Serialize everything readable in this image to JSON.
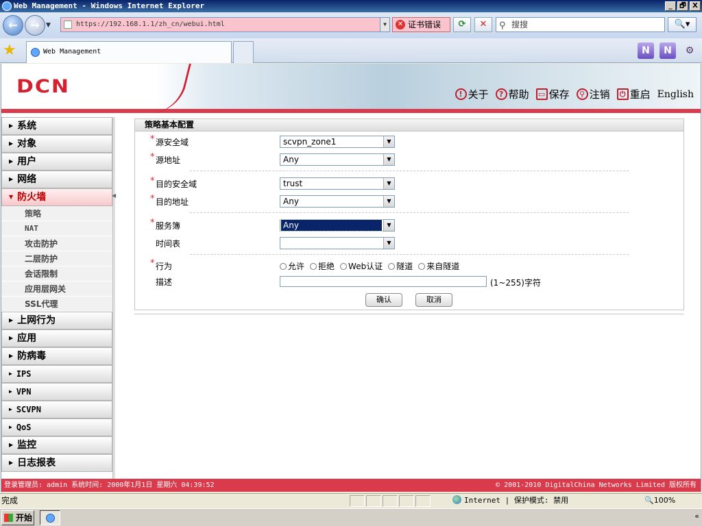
{
  "window": {
    "title": "Web Management - Windows Internet Explorer",
    "min": "_",
    "max": "🗗",
    "close": "X"
  },
  "browser": {
    "url": "https://192.168.1.1/zh_cn/webui.html",
    "cert_error": "证书错误",
    "search_placeholder": "搜搜",
    "tab_title": "Web Management"
  },
  "header": {
    "logo": "DCN",
    "links": [
      {
        "label": "关于",
        "icon": "info-icon",
        "glyph": "!"
      },
      {
        "label": "帮助",
        "icon": "help-icon",
        "glyph": "?"
      },
      {
        "label": "保存",
        "icon": "save-icon",
        "glyph": "▭"
      },
      {
        "label": "注销",
        "icon": "key-icon",
        "glyph": "⚲"
      },
      {
        "label": "重启",
        "icon": "restart-icon",
        "glyph": "⏻"
      },
      {
        "label": "English",
        "icon": "",
        "glyph": ""
      }
    ]
  },
  "sidebar": {
    "items": [
      {
        "label": "系统"
      },
      {
        "label": "对象"
      },
      {
        "label": "用户"
      },
      {
        "label": "网络"
      },
      {
        "label": "防火墙",
        "active": true
      },
      {
        "label": "上网行为"
      },
      {
        "label": "应用"
      },
      {
        "label": "防病毒"
      },
      {
        "label": "IPS"
      },
      {
        "label": "VPN"
      },
      {
        "label": "SCVPN"
      },
      {
        "label": "QoS"
      },
      {
        "label": "监控"
      },
      {
        "label": "日志报表"
      }
    ],
    "subitems": [
      "策略",
      "NAT",
      "攻击防护",
      "二层防护",
      "会话限制",
      "应用层网关",
      "SSL代理"
    ]
  },
  "form": {
    "title": "策略基本配置",
    "source_zone_label": "源安全域",
    "source_zone_value": "scvpn_zone1",
    "source_addr_label": "源地址",
    "source_addr_value": "Any",
    "dest_zone_label": "目的安全域",
    "dest_zone_value": "trust",
    "dest_addr_label": "目的地址",
    "dest_addr_value": "Any",
    "service_label": "服务簿",
    "service_value": "Any",
    "schedule_label": "时间表",
    "schedule_value": "",
    "action_label": "行为",
    "action_options": [
      "允许",
      "拒绝",
      "Web认证",
      "隧道",
      "来自隧道"
    ],
    "desc_label": "描述",
    "desc_value": "",
    "desc_hint": "(1~255)字符",
    "required_mark": "*",
    "confirm": "确认",
    "cancel": "取消"
  },
  "footer": {
    "left": "登录管理员: admin 系统时间: 2000年1月1日 星期六 04:39:52",
    "right": "© 2001-2010 DigitalChina Networks Limited 版权所有"
  },
  "status": {
    "text": "完成",
    "zone": "Internet | 保护模式: 禁用",
    "zoom": "🔍100%"
  },
  "taskbar": {
    "start": "开始"
  }
}
